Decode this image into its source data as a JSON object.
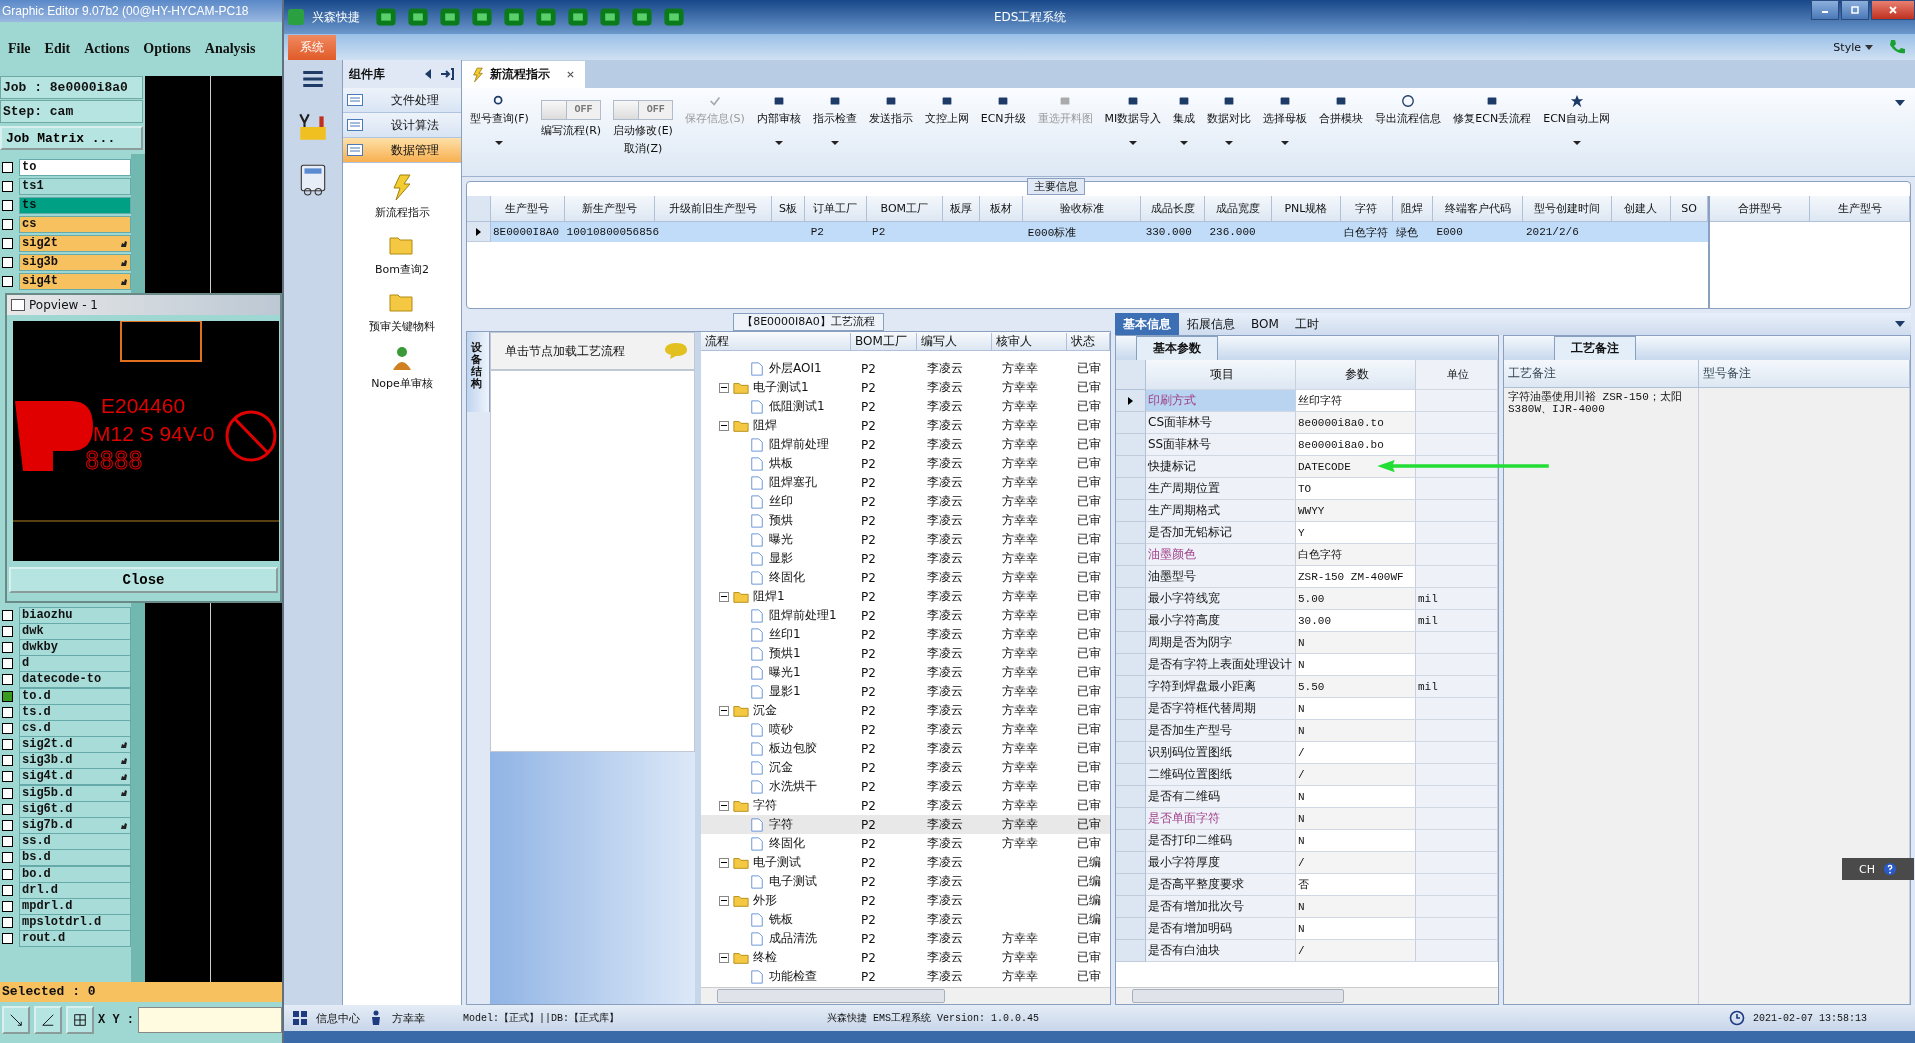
{
  "editor": {
    "title": "Graphic Editor 9.07b2 (00@HY-HYCAM-PC18",
    "menu": [
      "File",
      "Edit",
      "Actions",
      "Options",
      "Analysis"
    ],
    "job": "Job : 8e0000i8a0",
    "step": "Step: cam",
    "matrix_button": "Job Matrix ...",
    "layers_upper": [
      {
        "name": "to",
        "color": "#ffffff",
        "checked": false,
        "flag": false
      },
      {
        "name": "ts1",
        "color": "#a8dcd8",
        "checked": false,
        "flag": false
      },
      {
        "name": "ts",
        "color": "#00a085",
        "checked": false,
        "flag": false
      },
      {
        "name": "cs",
        "color": "#f7c160",
        "checked": false,
        "flag": false
      },
      {
        "name": "sig2t",
        "color": "#f7c160",
        "checked": false,
        "flag": true
      },
      {
        "name": "sig3b",
        "color": "#f7c160",
        "checked": false,
        "flag": true
      },
      {
        "name": "sig4t",
        "color": "#f7c160",
        "checked": false,
        "flag": true
      }
    ],
    "layers_lower": [
      {
        "name": "biaozhu",
        "color": "#a8dcd8",
        "checked": false,
        "flag": false
      },
      {
        "name": "dwk",
        "color": "#a8dcd8",
        "checked": false,
        "flag": false
      },
      {
        "name": "dwkby",
        "color": "#a8dcd8",
        "checked": false,
        "flag": false
      },
      {
        "name": "d",
        "color": "#a8dcd8",
        "checked": false,
        "flag": false
      },
      {
        "name": "datecode-to",
        "color": "#a8dcd8",
        "checked": false,
        "flag": false
      },
      {
        "name": "to.d",
        "color": "#a8dcd8",
        "checked": true,
        "flag": false
      },
      {
        "name": "ts.d",
        "color": "#a8dcd8",
        "checked": false,
        "flag": false
      },
      {
        "name": "cs.d",
        "color": "#a8dcd8",
        "checked": false,
        "flag": false
      },
      {
        "name": "sig2t.d",
        "color": "#a8dcd8",
        "checked": false,
        "flag": true
      },
      {
        "name": "sig3b.d",
        "color": "#a8dcd8",
        "checked": false,
        "flag": true
      },
      {
        "name": "sig4t.d",
        "color": "#a8dcd8",
        "checked": false,
        "flag": true
      },
      {
        "name": "sig5b.d",
        "color": "#a8dcd8",
        "checked": false,
        "flag": true
      },
      {
        "name": "sig6t.d",
        "color": "#a8dcd8",
        "checked": false,
        "flag": false
      },
      {
        "name": "sig7b.d",
        "color": "#a8dcd8",
        "checked": false,
        "flag": true
      },
      {
        "name": "ss.d",
        "color": "#a8dcd8",
        "checked": false,
        "flag": false
      },
      {
        "name": "bs.d",
        "color": "#a8dcd8",
        "checked": false,
        "flag": false
      },
      {
        "name": "bo.d",
        "color": "#a8dcd8",
        "checked": false,
        "flag": false
      },
      {
        "name": "drl.d",
        "color": "#a8dcd8",
        "checked": false,
        "flag": false
      },
      {
        "name": "mpdrl.d",
        "color": "#a8dcd8",
        "checked": false,
        "flag": false
      },
      {
        "name": "mpslotdrl.d",
        "color": "#a8dcd8",
        "checked": false,
        "flag": false
      },
      {
        "name": "rout.d",
        "color": "#a8dcd8",
        "checked": false,
        "flag": false
      }
    ],
    "selected_count": "Selected : 0",
    "xy_label": "X Y :"
  },
  "popview": {
    "title": "Popview - 1",
    "markings": [
      "E204460",
      "M12 S 94V-0"
    ],
    "date_digits": "8888",
    "close": "Close"
  },
  "app": {
    "title": "EDS工程系统",
    "quick_label": "兴森快捷",
    "ribbon_tabs": [
      {
        "label": "系统",
        "selected": true
      }
    ],
    "style_menu": "Style"
  },
  "component_library": {
    "title": "组件库",
    "categories": [
      {
        "label": "文件处理",
        "selected": false
      },
      {
        "label": "设计算法",
        "selected": false
      },
      {
        "label": "数据管理",
        "selected": true
      }
    ],
    "tools": [
      "新流程指示",
      "Bom查询2",
      "预审关键物料",
      "Nope单审核"
    ]
  },
  "document_tab": {
    "label": "新流程指示",
    "selected": true
  },
  "toolbar": [
    {
      "kind": "button",
      "label": "型号查询(F)",
      "dropdown": true,
      "disabled": false
    },
    {
      "kind": "toggle",
      "toggle_text": "OFF",
      "on": false,
      "label": "编写流程(R)"
    },
    {
      "kind": "toggle",
      "toggle_text": "OFF",
      "on": false,
      "label": "启动修改(E)",
      "label2": "取消(Z)"
    },
    {
      "kind": "button",
      "label": "保存信息(S)",
      "dropdown": false,
      "disabled": true
    },
    {
      "kind": "button",
      "label": "内部审核",
      "dropdown": true,
      "disabled": false
    },
    {
      "kind": "button",
      "label": "指示检查",
      "dropdown": true,
      "disabled": false
    },
    {
      "kind": "button",
      "label": "发送指示",
      "dropdown": false,
      "disabled": false
    },
    {
      "kind": "button",
      "label": "文控上网",
      "dropdown": false,
      "disabled": false
    },
    {
      "kind": "button",
      "label": "ECN升级",
      "dropdown": false,
      "disabled": false
    },
    {
      "kind": "button",
      "label": "重选开料图",
      "dropdown": false,
      "disabled": true
    },
    {
      "kind": "button",
      "label": "MI数据导入",
      "dropdown": true,
      "disabled": false
    },
    {
      "kind": "button",
      "label": "集成",
      "dropdown": true,
      "disabled": false
    },
    {
      "kind": "button",
      "label": "数据对比",
      "dropdown": true,
      "disabled": false
    },
    {
      "kind": "button",
      "label": "选择母板",
      "dropdown": true,
      "disabled": false
    },
    {
      "kind": "button",
      "label": "合拼模块",
      "dropdown": false,
      "disabled": false
    },
    {
      "kind": "button",
      "label": "导出流程信息",
      "dropdown": false,
      "disabled": false
    },
    {
      "kind": "button",
      "label": "修复ECN丢流程",
      "dropdown": false,
      "disabled": false
    },
    {
      "kind": "button",
      "label": "ECN自动上网",
      "dropdown": true,
      "disabled": false
    }
  ],
  "main_info": {
    "title": "主要信息",
    "columns": [
      "生产型号",
      "新生产型号",
      "升级前旧生产型号",
      "S板",
      "订单工厂",
      "BOM工厂",
      "板厚",
      "板材",
      "验收标准",
      "成品长度",
      "成品宽度",
      "PNL规格",
      "字符",
      "阻焊",
      "终端客户代码",
      "型号创建时间",
      "创建人",
      "SO"
    ],
    "rows": [
      {
        "selected": true,
        "cells": [
          "8E0000I8A0",
          "10010800056856",
          null,
          null,
          "P2",
          "P2",
          null,
          null,
          "E000标准",
          "330.000",
          "236.000",
          null,
          "白色字符",
          "绿色",
          "E000",
          "2021/2/6",
          null,
          null
        ]
      }
    ],
    "side_columns": [
      "合拼型号",
      "生产型号"
    ]
  },
  "process_flow": {
    "title": "【8E0000I8A0】工艺流程",
    "side_tab": "设备结构",
    "hint": "单击节点加载工艺流程",
    "columns": [
      "流程",
      "BOM工厂",
      "编写人",
      "核审人",
      "状态"
    ],
    "rows": [
      {
        "kind": "file",
        "label": "外层AOI1",
        "factory": "P2",
        "writer": "李凌云",
        "reviewer": "方幸幸",
        "status": "已审",
        "selected": false
      },
      {
        "kind": "folder",
        "label": "电子测试1",
        "factory": "P2",
        "writer": "李凌云",
        "reviewer": "方幸幸",
        "status": "已审",
        "selected": false,
        "expanded": true,
        "children": [
          {
            "kind": "file",
            "label": "低阻测试1",
            "factory": "P2",
            "writer": "李凌云",
            "reviewer": "方幸幸",
            "status": "已审",
            "selected": false
          }
        ]
      },
      {
        "kind": "folder",
        "label": "阻焊",
        "factory": "P2",
        "writer": "李凌云",
        "reviewer": "方幸幸",
        "status": "已审",
        "selected": false,
        "expanded": true,
        "children": [
          {
            "kind": "file",
            "label": "阻焊前处理",
            "factory": "P2",
            "writer": "李凌云",
            "reviewer": "方幸幸",
            "status": "已审",
            "selected": false
          },
          {
            "kind": "file",
            "label": "烘板",
            "factory": "P2",
            "writer": "李凌云",
            "reviewer": "方幸幸",
            "status": "已审",
            "selected": false
          },
          {
            "kind": "file",
            "label": "阻焊塞孔",
            "factory": "P2",
            "writer": "李凌云",
            "reviewer": "方幸幸",
            "status": "已审",
            "selected": false
          },
          {
            "kind": "file",
            "label": "丝印",
            "factory": "P2",
            "writer": "李凌云",
            "reviewer": "方幸幸",
            "status": "已审",
            "selected": false
          },
          {
            "kind": "file",
            "label": "预烘",
            "factory": "P2",
            "writer": "李凌云",
            "reviewer": "方幸幸",
            "status": "已审",
            "selected": false
          },
          {
            "kind": "file",
            "label": "曝光",
            "factory": "P2",
            "writer": "李凌云",
            "reviewer": "方幸幸",
            "status": "已审",
            "selected": false
          },
          {
            "kind": "file",
            "label": "显影",
            "factory": "P2",
            "writer": "李凌云",
            "reviewer": "方幸幸",
            "status": "已审",
            "selected": false
          },
          {
            "kind": "file",
            "label": "终固化",
            "factory": "P2",
            "writer": "李凌云",
            "reviewer": "方幸幸",
            "status": "已审",
            "selected": false
          }
        ]
      },
      {
        "kind": "folder",
        "label": "阻焊1",
        "factory": "P2",
        "writer": "李凌云",
        "reviewer": "方幸幸",
        "status": "已审",
        "selected": false,
        "expanded": true,
        "children": [
          {
            "kind": "file",
            "label": "阻焊前处理1",
            "factory": "P2",
            "writer": "李凌云",
            "reviewer": "方幸幸",
            "status": "已审",
            "selected": false
          },
          {
            "kind": "file",
            "label": "丝印1",
            "factory": "P2",
            "writer": "李凌云",
            "reviewer": "方幸幸",
            "status": "已审",
            "selected": false
          },
          {
            "kind": "file",
            "label": "预烘1",
            "factory": "P2",
            "writer": "李凌云",
            "reviewer": "方幸幸",
            "status": "已审",
            "selected": false
          },
          {
            "kind": "file",
            "label": "曝光1",
            "factory": "P2",
            "writer": "李凌云",
            "reviewer": "方幸幸",
            "status": "已审",
            "selected": false
          },
          {
            "kind": "file",
            "label": "显影1",
            "factory": "P2",
            "writer": "李凌云",
            "reviewer": "方幸幸",
            "status": "已审",
            "selected": false
          }
        ]
      },
      {
        "kind": "folder",
        "label": "沉金",
        "factory": "P2",
        "writer": "李凌云",
        "reviewer": "方幸幸",
        "status": "已审",
        "selected": false,
        "expanded": true,
        "children": [
          {
            "kind": "file",
            "label": "喷砂",
            "factory": "P2",
            "writer": "李凌云",
            "reviewer": "方幸幸",
            "status": "已审",
            "selected": false
          },
          {
            "kind": "file",
            "label": "板边包胶",
            "factory": "P2",
            "writer": "李凌云",
            "reviewer": "方幸幸",
            "status": "已审",
            "selected": false
          },
          {
            "kind": "file",
            "label": "沉金",
            "factory": "P2",
            "writer": "李凌云",
            "reviewer": "方幸幸",
            "status": "已审",
            "selected": false
          },
          {
            "kind": "file",
            "label": "水洗烘干",
            "factory": "P2",
            "writer": "李凌云",
            "reviewer": "方幸幸",
            "status": "已审",
            "selected": false
          }
        ]
      },
      {
        "kind": "folder",
        "label": "字符",
        "factory": "P2",
        "writer": "李凌云",
        "reviewer": "方幸幸",
        "status": "已审",
        "selected": false,
        "expanded": true,
        "children": [
          {
            "kind": "file",
            "label": "字符",
            "factory": "P2",
            "writer": "李凌云",
            "reviewer": "方幸幸",
            "status": "已审",
            "selected": true
          },
          {
            "kind": "file",
            "label": "终固化",
            "factory": "P2",
            "writer": "李凌云",
            "reviewer": "方幸幸",
            "status": "已审",
            "selected": false
          }
        ]
      },
      {
        "kind": "folder",
        "label": "电子测试",
        "factory": "P2",
        "writer": "李凌云",
        "status": "已编",
        "selected": false,
        "expanded": true,
        "children": [
          {
            "kind": "file",
            "label": "电子测试",
            "factory": "P2",
            "writer": "李凌云",
            "status": "已编",
            "selected": false
          }
        ]
      },
      {
        "kind": "folder",
        "label": "外形",
        "factory": "P2",
        "writer": "李凌云",
        "status": "已编",
        "selected": false,
        "expanded": true,
        "children": [
          {
            "kind": "file",
            "label": "铣板",
            "factory": "P2",
            "writer": "李凌云",
            "status": "已编",
            "selected": false
          },
          {
            "kind": "file",
            "label": "成品清洗",
            "factory": "P2",
            "writer": "李凌云",
            "reviewer": "方幸幸",
            "status": "已审",
            "selected": false
          }
        ]
      },
      {
        "kind": "folder",
        "label": "终检",
        "factory": "P2",
        "writer": "李凌云",
        "reviewer": "方幸幸",
        "status": "已审",
        "selected": false,
        "expanded": true,
        "children": [
          {
            "kind": "file",
            "label": "功能检查",
            "factory": "P2",
            "writer": "李凌云",
            "reviewer": "方幸幸",
            "status": "已审",
            "selected": false
          }
        ]
      }
    ]
  },
  "info_tabs": [
    {
      "label": "基本信息",
      "selected": true
    },
    {
      "label": "拓展信息",
      "selected": false
    },
    {
      "label": "BOM",
      "selected": false
    },
    {
      "label": "工时",
      "selected": false
    }
  ],
  "basic_params": {
    "title": "基本参数",
    "columns": [
      "项目",
      "参数",
      "单位"
    ],
    "rows": [
      {
        "item": "印刷方式",
        "value": "丝印字符",
        "emphasis": true,
        "selected": true
      },
      {
        "item": "CS面菲林号",
        "value": "8e0000i8a0.to",
        "emphasis": false,
        "selected": false
      },
      {
        "item": "SS面菲林号",
        "value": "8e0000i8a0.bo",
        "emphasis": false,
        "selected": false
      },
      {
        "item": "快捷标记",
        "value": "DATECODE",
        "emphasis": false,
        "selected": false
      },
      {
        "item": "生产周期位置",
        "value": "TO",
        "emphasis": false,
        "selected": false
      },
      {
        "item": "生产周期格式",
        "value": "WWYY",
        "emphasis": false,
        "selected": false
      },
      {
        "item": "是否加无铅标记",
        "value": "Y",
        "emphasis": false,
        "selected": false
      },
      {
        "item": "油墨颜色",
        "value": "白色字符",
        "emphasis": true,
        "selected": false
      },
      {
        "item": "油墨型号",
        "value": "ZSR-150 ZM-400WF",
        "emphasis": false,
        "selected": false
      },
      {
        "item": "最小字符线宽",
        "value": "5.00",
        "unit": "mil",
        "emphasis": false,
        "selected": false
      },
      {
        "item": "最小字符高度",
        "value": "30.00",
        "unit": "mil",
        "emphasis": false,
        "selected": false
      },
      {
        "item": "周期是否为阴字",
        "value": "N",
        "emphasis": false,
        "selected": false
      },
      {
        "item": "是否有字符上表面处理设计",
        "value": "N",
        "emphasis": false,
        "selected": false
      },
      {
        "item": "字符到焊盘最小距离",
        "value": "5.50",
        "unit": "mil",
        "emphasis": false,
        "selected": false
      },
      {
        "item": "是否字符框代替周期",
        "value": "N",
        "emphasis": false,
        "selected": false
      },
      {
        "item": "是否加生产型号",
        "value": "N",
        "emphasis": false,
        "selected": false
      },
      {
        "item": "识别码位置图纸",
        "value": "/",
        "emphasis": false,
        "selected": false
      },
      {
        "item": "二维码位置图纸",
        "value": "/",
        "emphasis": false,
        "selected": false
      },
      {
        "item": "是否有二维码",
        "value": "N",
        "emphasis": false,
        "selected": false
      },
      {
        "item": "是否单面字符",
        "value": "N",
        "emphasis": true,
        "selected": false
      },
      {
        "item": "是否打印二维码",
        "value": "N",
        "emphasis": false,
        "selected": false
      },
      {
        "item": "最小字符厚度",
        "value": "/",
        "emphasis": false,
        "selected": false
      },
      {
        "item": "是否高平整度要求",
        "value": "否",
        "emphasis": false,
        "selected": false
      },
      {
        "item": "是否有增加批次号",
        "value": "N",
        "emphasis": false,
        "selected": false
      },
      {
        "item": "是否有增加明码",
        "value": "N",
        "emphasis": false,
        "selected": false
      },
      {
        "item": "是否有白油块",
        "value": "/",
        "emphasis": false,
        "selected": false
      }
    ]
  },
  "process_notes": {
    "title": "工艺备注",
    "columns": [
      "工艺备注",
      "型号备注"
    ],
    "note": "字符油墨使用川裕 ZSR-150；太阳S380W、IJR-4000"
  },
  "ime_bar": {
    "label": "CH"
  },
  "status_bar": {
    "info_center": "信息中心",
    "user": "方幸幸",
    "model": "Model:【正式】||DB:【正式库】",
    "version": "兴森快捷 EMS工程系统 Version: 1.0.0.45",
    "datetime": "2021-02-07 13:58:13"
  }
}
